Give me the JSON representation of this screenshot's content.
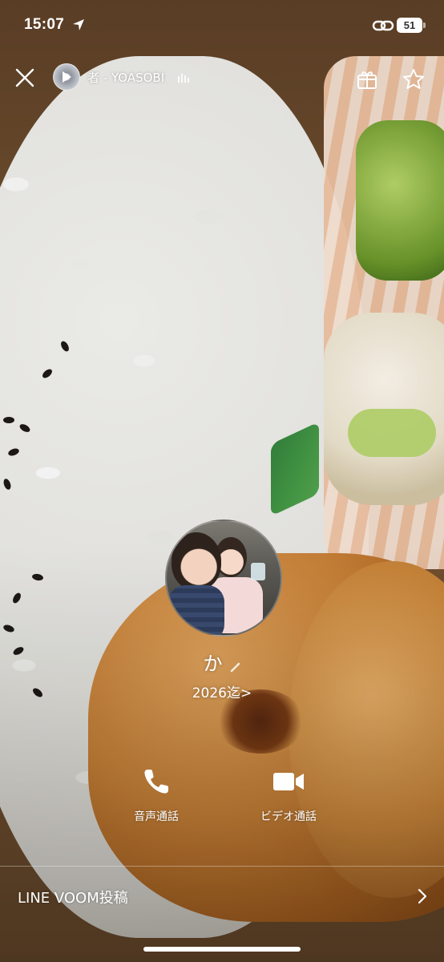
{
  "status_bar": {
    "time": "15:07",
    "battery": "51"
  },
  "top_bar": {
    "music_track": "者 - YOASOBI"
  },
  "profile": {
    "name": "か",
    "status_message": "2026迄>"
  },
  "actions": [
    {
      "label": "音声通話",
      "icon": "phone-icon"
    },
    {
      "label": "ビデオ通話",
      "icon": "video-camera-icon"
    }
  ],
  "voom": {
    "label": "LINE VOOM投稿"
  },
  "colors": {
    "foreground": "#ffffff"
  }
}
